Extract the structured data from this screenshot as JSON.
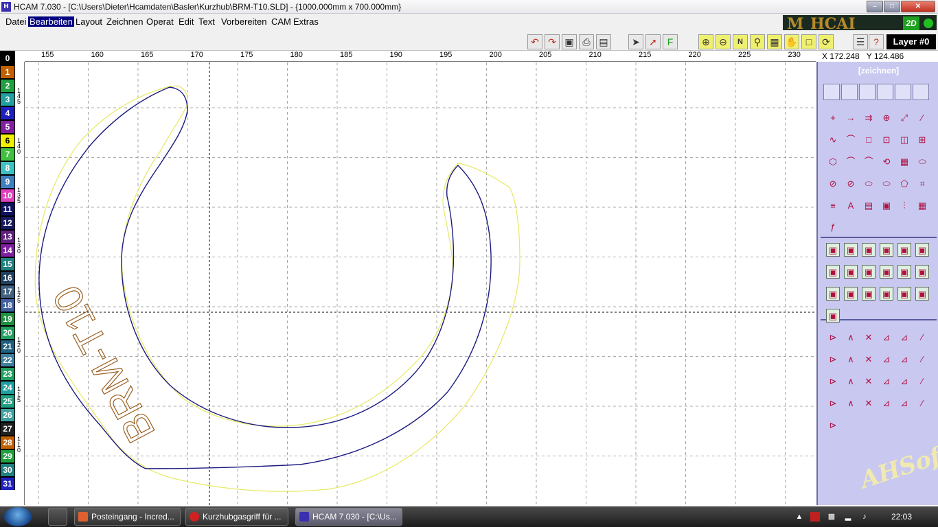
{
  "window": {
    "title": "HCAM 7.030 - [C:\\Users\\Dieter\\Hcamdaten\\Basler\\Kurzhub\\BRM-T10.SLD] - {1000.000mm x 700.000mm}",
    "app_icon": "H"
  },
  "menu": [
    {
      "label": "Datei"
    },
    {
      "label": "Bearbeiten"
    },
    {
      "label": "Layout"
    },
    {
      "label": "Zeichnen"
    },
    {
      "label": "Operat"
    },
    {
      "label": "Edit"
    },
    {
      "label": "Text"
    },
    {
      "label": "Vorbereiten"
    },
    {
      "label": "CAM"
    },
    {
      "label": "Extras"
    }
  ],
  "logo": {
    "m": "M",
    "hcam": "HCAI",
    "mode": "2D"
  },
  "layer": {
    "current": "Layer #0"
  },
  "coords": {
    "x": "X 172.248",
    "y": "Y 124.486"
  },
  "layers": [
    "0",
    "1",
    "2",
    "3",
    "4",
    "5",
    "6",
    "7",
    "8",
    "9",
    "10",
    "11",
    "12",
    "13",
    "14",
    "15",
    "16",
    "17",
    "18",
    "19",
    "20",
    "21",
    "22",
    "23",
    "24",
    "25",
    "26",
    "27",
    "28",
    "29",
    "30",
    "31"
  ],
  "layer_colors": [
    "#000000",
    "#c06000",
    "#20a040",
    "#20a0a0",
    "#2020c0",
    "#8020a0",
    "#f0f000",
    "#40c040",
    "#40c0c0",
    "#4080c0",
    "#e040c0",
    "#101060",
    "#181860",
    "#602080",
    "#8020a0",
    "#208080",
    "#204060",
    "#406080",
    "#4060a0",
    "#209040",
    "#20a060",
    "#206080",
    "#4080a0",
    "#20a060",
    "#20a0a0",
    "#20a080",
    "#40a0a0",
    "#202020",
    "#c06000",
    "#20a040",
    "#208080",
    "#2020c0"
  ],
  "ruler_top": [
    "155",
    "160",
    "165",
    "170",
    "175",
    "180",
    "185",
    "190",
    "195",
    "200",
    "205",
    "210",
    "215",
    "220",
    "225",
    "230"
  ],
  "ruler_left": [
    "145",
    "140",
    "135",
    "130",
    "125",
    "120",
    "115",
    "110"
  ],
  "drawing": {
    "engraving_text": "BRM-T10"
  },
  "panel": {
    "title": "[zeichnen]",
    "watermark": "AHSoft"
  },
  "taskbar": {
    "items": [
      {
        "label": "Posteingang - Incred..."
      },
      {
        "label": "Kurzhubgasgriff für ..."
      },
      {
        "label": "HCAM 7.030 - [C:\\Us..."
      }
    ],
    "clock": "22:03"
  },
  "colors": {
    "outer_contour": "#e8e860",
    "inner_contour": "#1a1a80",
    "text_engraving": "#9a6020",
    "panel_bg": "#c8c8f0"
  }
}
